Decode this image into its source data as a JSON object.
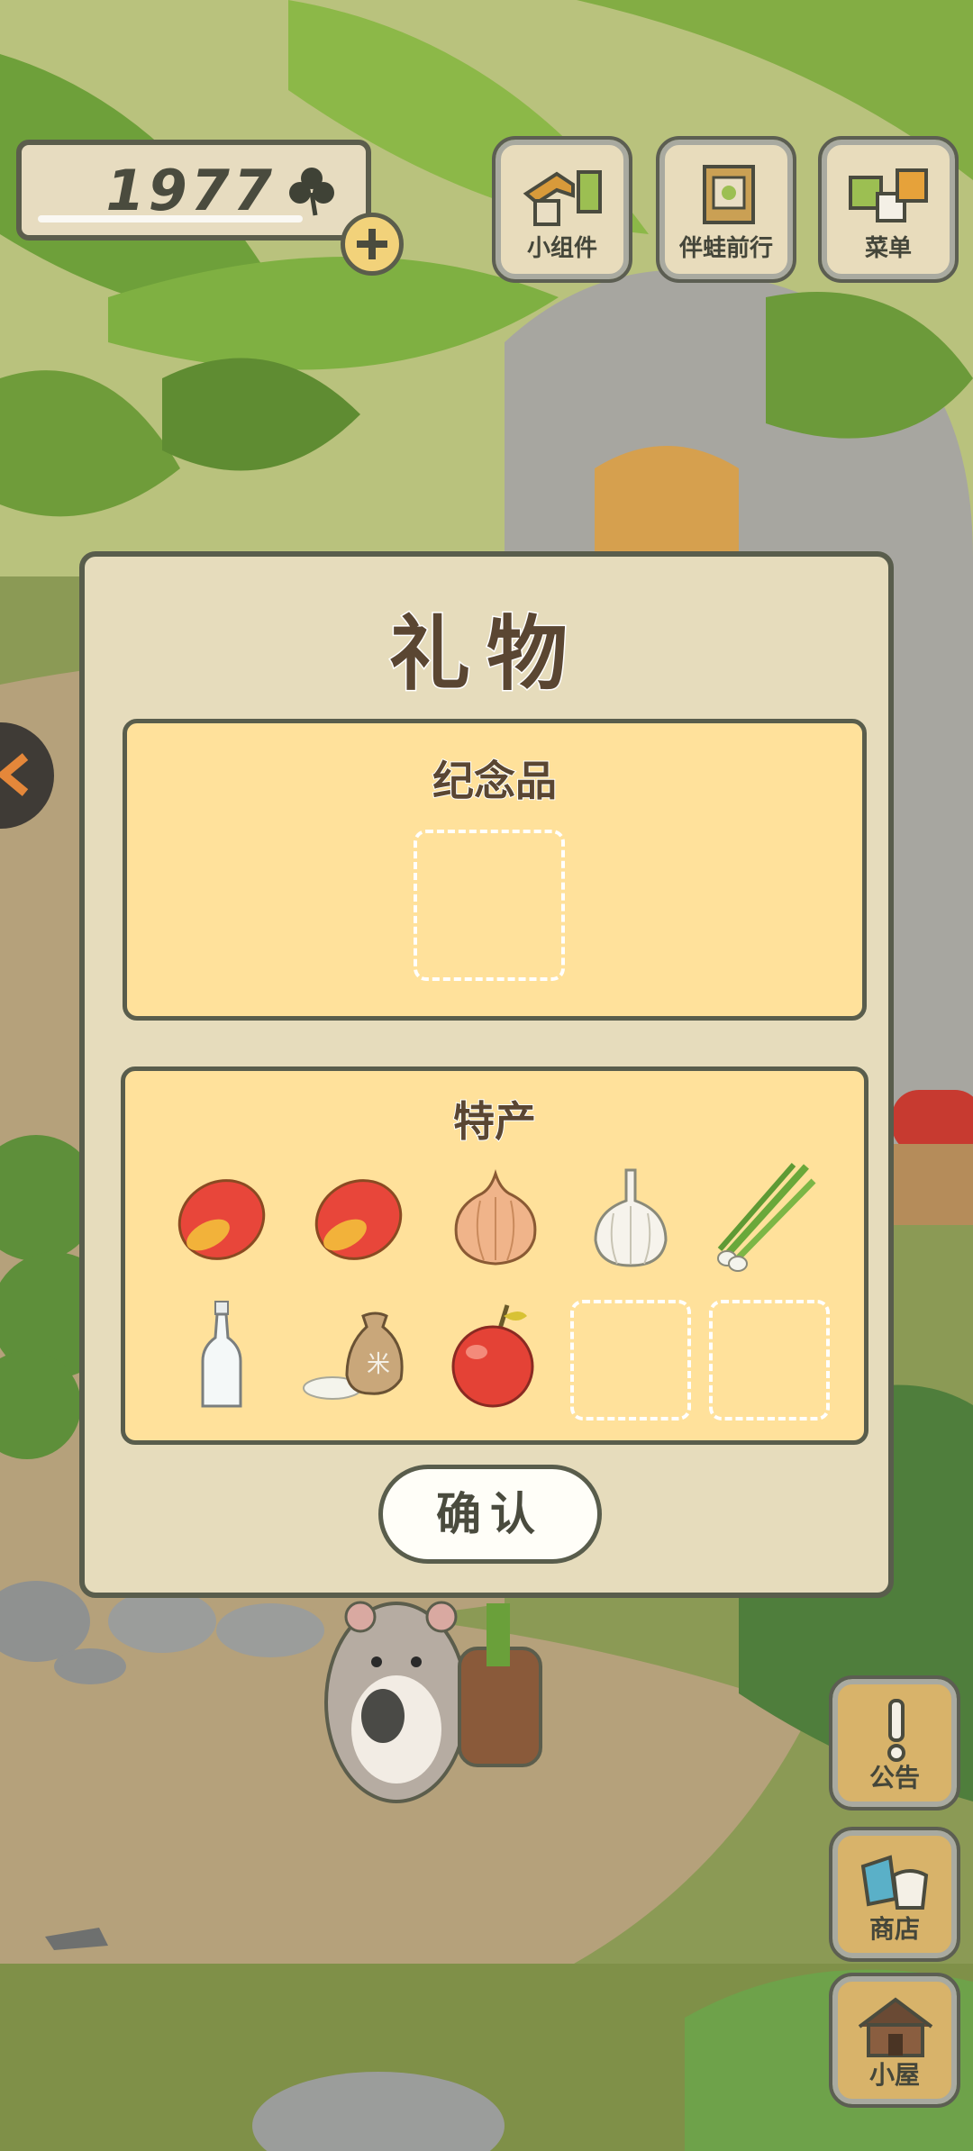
{
  "currency": {
    "count": "1977",
    "icon": "clover-icon",
    "add_icon": "plus-icon"
  },
  "top_menu": [
    {
      "label": "小组件",
      "icon": "widget-icon"
    },
    {
      "label": "伴蛙前行",
      "icon": "album-icon"
    },
    {
      "label": "菜单",
      "icon": "menu-cards-icon"
    }
  ],
  "dialog": {
    "title": "礼物",
    "souvenir": {
      "title": "纪念品",
      "slots_empty": 1
    },
    "specialty": {
      "title": "特产",
      "items": [
        {
          "name": "mango",
          "icon": "mango-icon"
        },
        {
          "name": "mango",
          "icon": "mango-icon"
        },
        {
          "name": "onion",
          "icon": "onion-icon"
        },
        {
          "name": "garlic",
          "icon": "garlic-icon"
        },
        {
          "name": "green-onion",
          "icon": "green-onion-icon"
        },
        {
          "name": "bottle",
          "icon": "bottle-icon"
        },
        {
          "name": "rice-sack",
          "icon": "rice-sack-icon",
          "sack_text": "米"
        },
        {
          "name": "apple",
          "icon": "apple-icon"
        }
      ],
      "slots_empty": 2
    },
    "confirm_label": "确认"
  },
  "side_menu": [
    {
      "label": "公告",
      "icon": "exclamation-icon"
    },
    {
      "label": "商店",
      "icon": "shop-bags-icon"
    },
    {
      "label": "小屋",
      "icon": "house-icon"
    }
  ],
  "colors": {
    "panel": "#ffe19b",
    "dialog": "#e6dcbc",
    "border": "#595d4c",
    "title_text": "#5a4632"
  }
}
